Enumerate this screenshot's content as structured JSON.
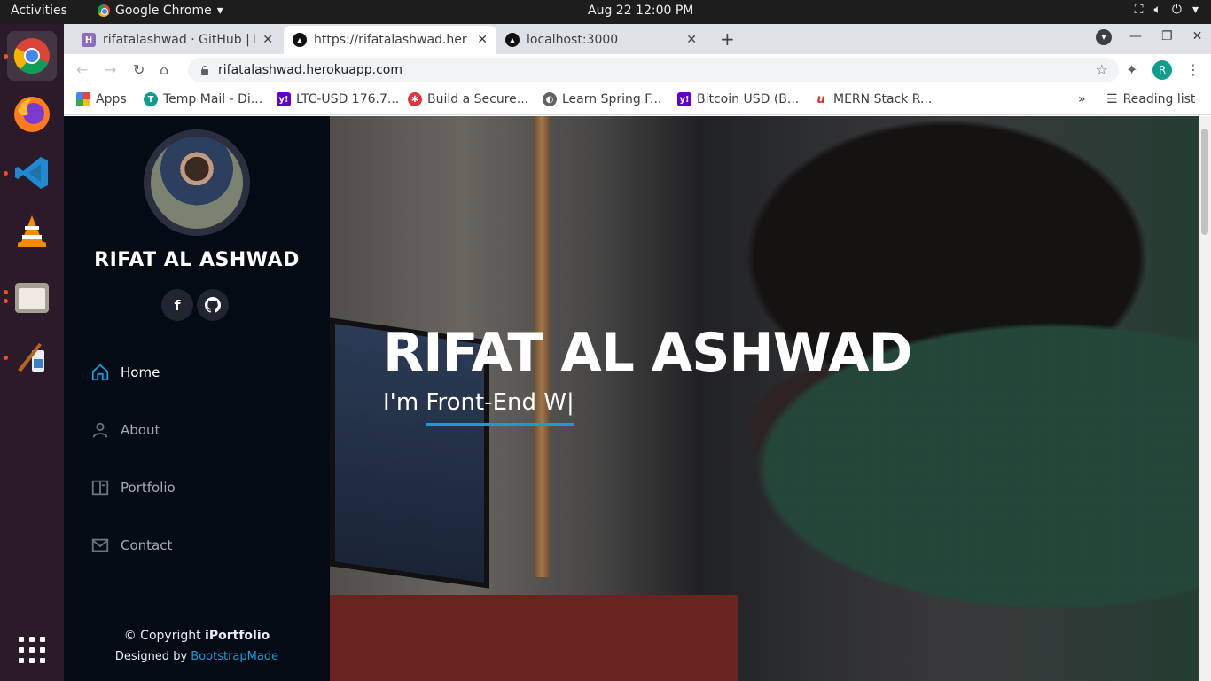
{
  "os": {
    "activities": "Activities",
    "app_menu": "Google Chrome",
    "clock": "Aug 22  12:00 PM"
  },
  "browser": {
    "tabs": [
      {
        "title": "rifatalashwad · GitHub | H",
        "favicon_color": "#8e6bbf",
        "favicon_glyph": "H"
      },
      {
        "title": "https://rifatalashwad.her",
        "favicon_color": "#111111",
        "favicon_glyph": "▲"
      },
      {
        "title": "localhost:3000",
        "favicon_color": "#111111",
        "favicon_glyph": "▲"
      }
    ],
    "url": "rifatalashwad.herokuapp.com",
    "profile_initial": "R",
    "bookmarks": [
      {
        "label": "Apps",
        "color": "#ea4335",
        "glyph": "⋮"
      },
      {
        "label": "Temp Mail - Di...",
        "color": "#0f9d8e",
        "glyph": "T"
      },
      {
        "label": "LTC-USD 176.7...",
        "color": "#6001d2",
        "glyph": "y!"
      },
      {
        "label": "Build a Secure...",
        "color": "#e0343c",
        "glyph": "✱"
      },
      {
        "label": "Learn Spring F...",
        "color": "#5f6368",
        "glyph": "◐"
      },
      {
        "label": "Bitcoin USD (B...",
        "color": "#6001d2",
        "glyph": "y!"
      },
      {
        "label": "MERN Stack R...",
        "color": "#d93025",
        "glyph": "u"
      }
    ],
    "more_bookmarks": "»",
    "reading_list": "Reading list"
  },
  "site": {
    "profile_name": "RIFAT AL ASHWAD",
    "social": [
      {
        "name": "facebook",
        "glyph": "f"
      },
      {
        "name": "github",
        "glyph": "◉"
      }
    ],
    "nav": [
      {
        "label": "Home",
        "icon": "home-icon",
        "active": true
      },
      {
        "label": "About",
        "icon": "person-icon",
        "active": false
      },
      {
        "label": "Portfolio",
        "icon": "book-icon",
        "active": false
      },
      {
        "label": "Contact",
        "icon": "envelope-icon",
        "active": false
      }
    ],
    "footer": {
      "copyright_prefix": "© Copyright ",
      "brand": "iPortfolio",
      "designed_by": "Designed by ",
      "designer": "BootstrapMade"
    },
    "hero": {
      "title": "RIFAT AL ASHWAD",
      "prefix": "I'm ",
      "typed": "Front-End W|"
    },
    "accent": "#149ddd"
  }
}
